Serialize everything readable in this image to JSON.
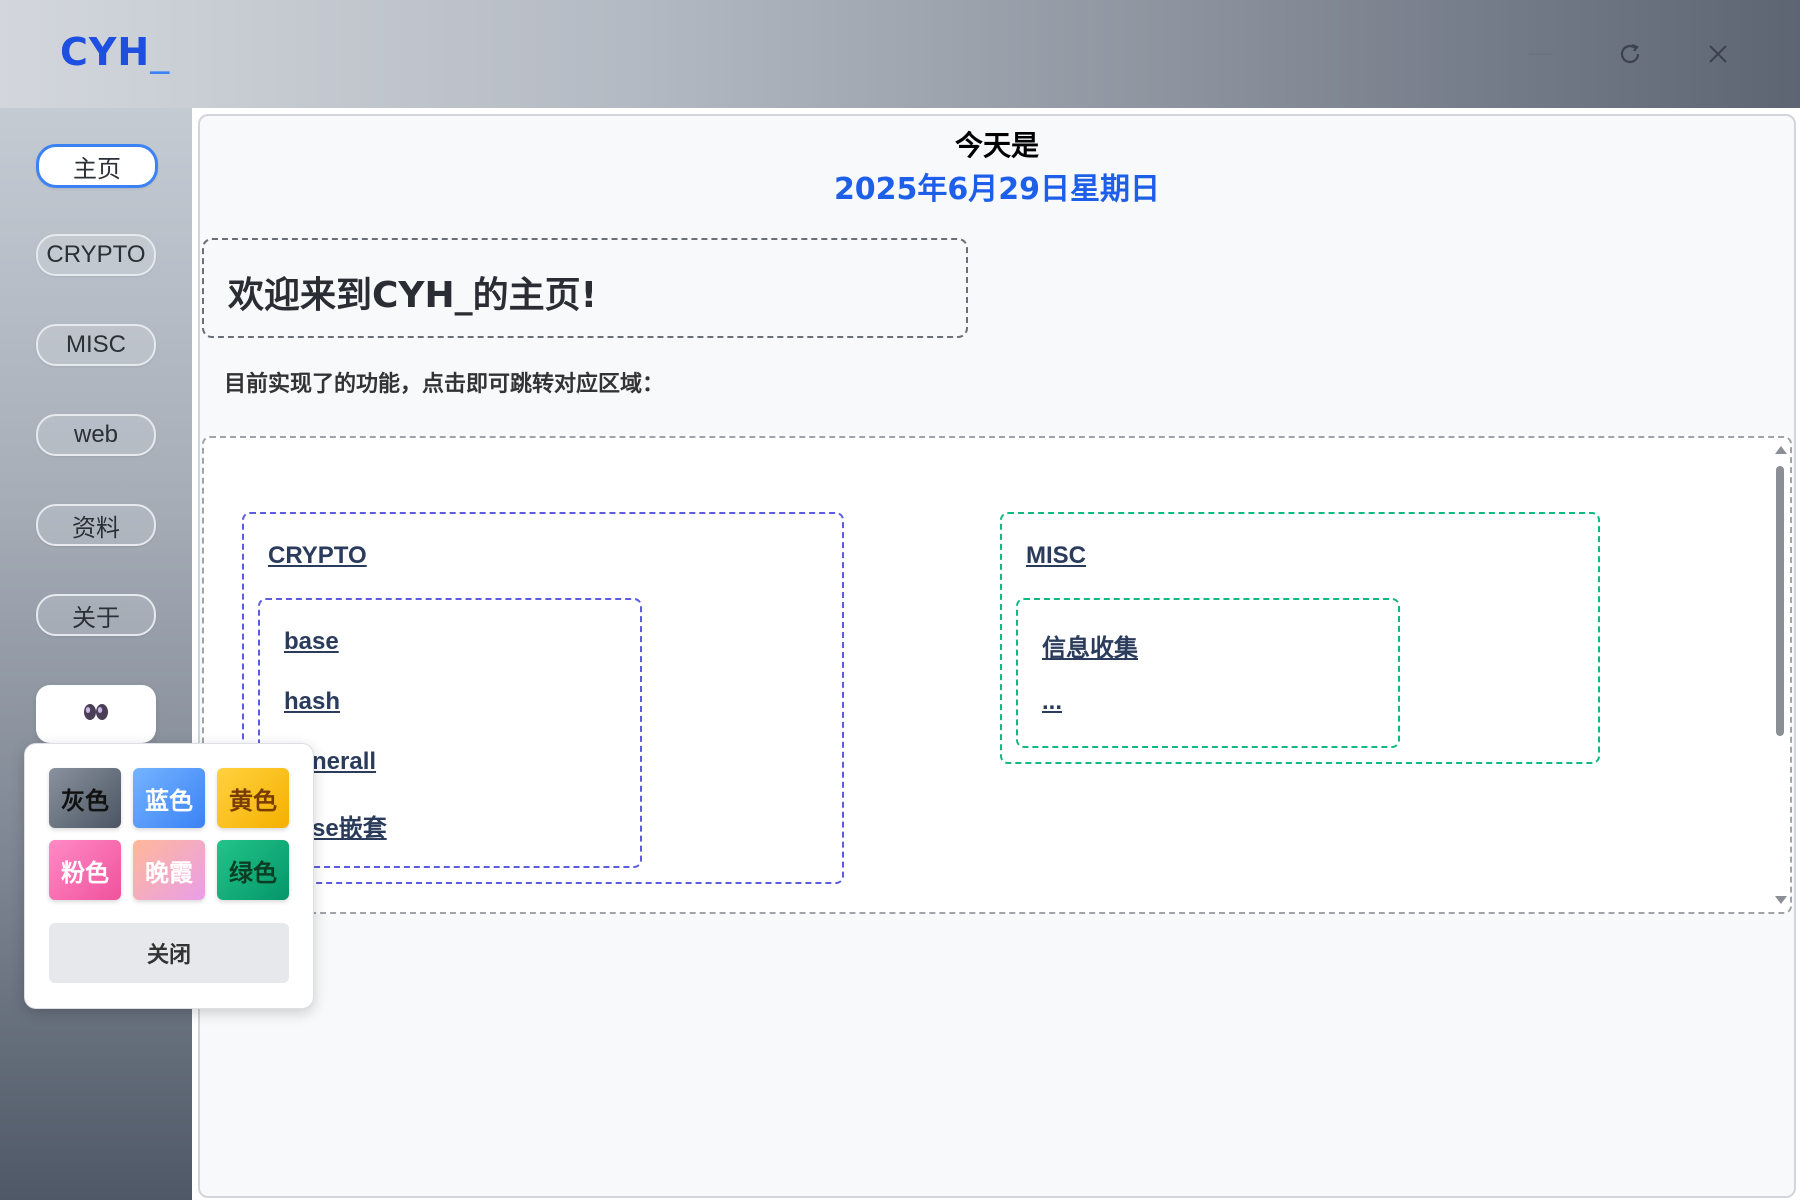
{
  "app": {
    "logo": "CYH",
    "logo_cursor": "_"
  },
  "window_controls": {
    "minimize_icon": "minimize-icon",
    "refresh_icon": "refresh-icon",
    "close_icon": "close-icon"
  },
  "sidebar": {
    "items": [
      {
        "label": "主页",
        "active": true
      },
      {
        "label": "CRYPTO",
        "active": false
      },
      {
        "label": "MISC",
        "active": false
      },
      {
        "label": "web",
        "active": false
      },
      {
        "label": "资料",
        "active": false
      },
      {
        "label": "关于",
        "active": false
      }
    ],
    "theme_toggle_icon": "eyes-icon"
  },
  "theme_popup": {
    "swatches": [
      {
        "label": "灰色",
        "color": "#5d6675"
      },
      {
        "label": "蓝色",
        "color": "#4c9cf6"
      },
      {
        "label": "黄色",
        "color": "#f5b700"
      },
      {
        "label": "粉色",
        "color": "#f472b6"
      },
      {
        "label": "晚霞",
        "color": "#f9a8a8"
      },
      {
        "label": "绿色",
        "color": "#10b981"
      }
    ],
    "close_label": "关闭"
  },
  "main": {
    "today_label": "今天是",
    "today_date": "2025年6月29日星期日",
    "welcome": "欢迎来到CYH_的主页!",
    "features_desc": "目前实现了的功能，点击即可跳转对应区域：",
    "categories": [
      {
        "title": "CRYPTO",
        "color": "#5b5ce0",
        "links": [
          "base",
          "hash",
          "generall",
          "base嵌套"
        ]
      },
      {
        "title": "MISC",
        "color": "#10b981",
        "links": [
          "信息收集",
          "..."
        ]
      }
    ]
  }
}
